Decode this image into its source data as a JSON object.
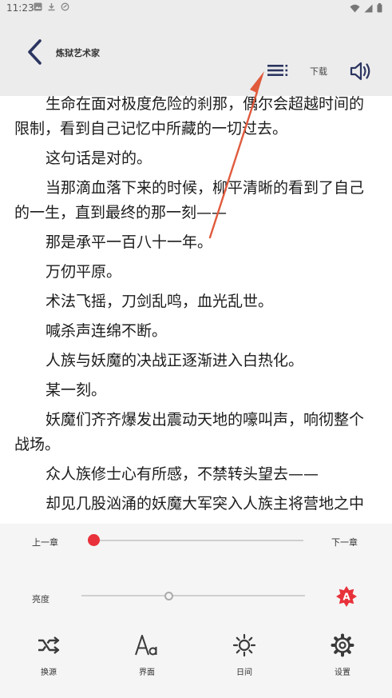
{
  "status_bar": {
    "time": "11:23",
    "icons": [
      "gallery-icon",
      "download-icon",
      "sync-icon"
    ],
    "right_icons": [
      "wifi-icon",
      "signal-icon",
      "battery-icon"
    ]
  },
  "header": {
    "title": "炼狱艺术家",
    "download_label": "下载",
    "icons": [
      "back-icon",
      "menu-icon",
      "speaker-icon"
    ]
  },
  "reader": {
    "paragraphs": [
      "生命在面对极度危险的刹那，偶尔会超越时间的限制，看到自己记忆中所藏的一切过去。",
      "这句话是对的。",
      "当那滴血落下来的时候，柳平清晰的看到了自己的一生，直到最终的那一刻——",
      "那是承平一百八十一年。",
      "万仞平原。",
      "术法飞摇，刀剑乱鸣，血光乱世。",
      "喊杀声连绵不断。",
      "人族与妖魔的决战正逐渐进入白热化。",
      "某一刻。",
      "妖魔们齐齐爆发出震动天地的嚎叫声，响彻整个战场。",
      "众人族修士心有所感，不禁转头望去——",
      "却见几股汹涌的妖魔大军突入人族主将营地之中"
    ]
  },
  "controls": {
    "prev_chapter": "上一章",
    "next_chapter": "下一章",
    "progress_fraction": 0.0,
    "brightness_label": "亮度",
    "brightness_fraction": 0.39,
    "auto_icon": "auto-brightness-icon",
    "accent_color": "#e8313a"
  },
  "toolbar": {
    "items": [
      {
        "label": "换源",
        "icon": "switch-source-icon"
      },
      {
        "label": "界面",
        "icon": "font-icon"
      },
      {
        "label": "日间",
        "icon": "sun-icon"
      },
      {
        "label": "设置",
        "icon": "gear-icon"
      }
    ]
  },
  "annotation": {
    "color": "#e05a3c"
  }
}
